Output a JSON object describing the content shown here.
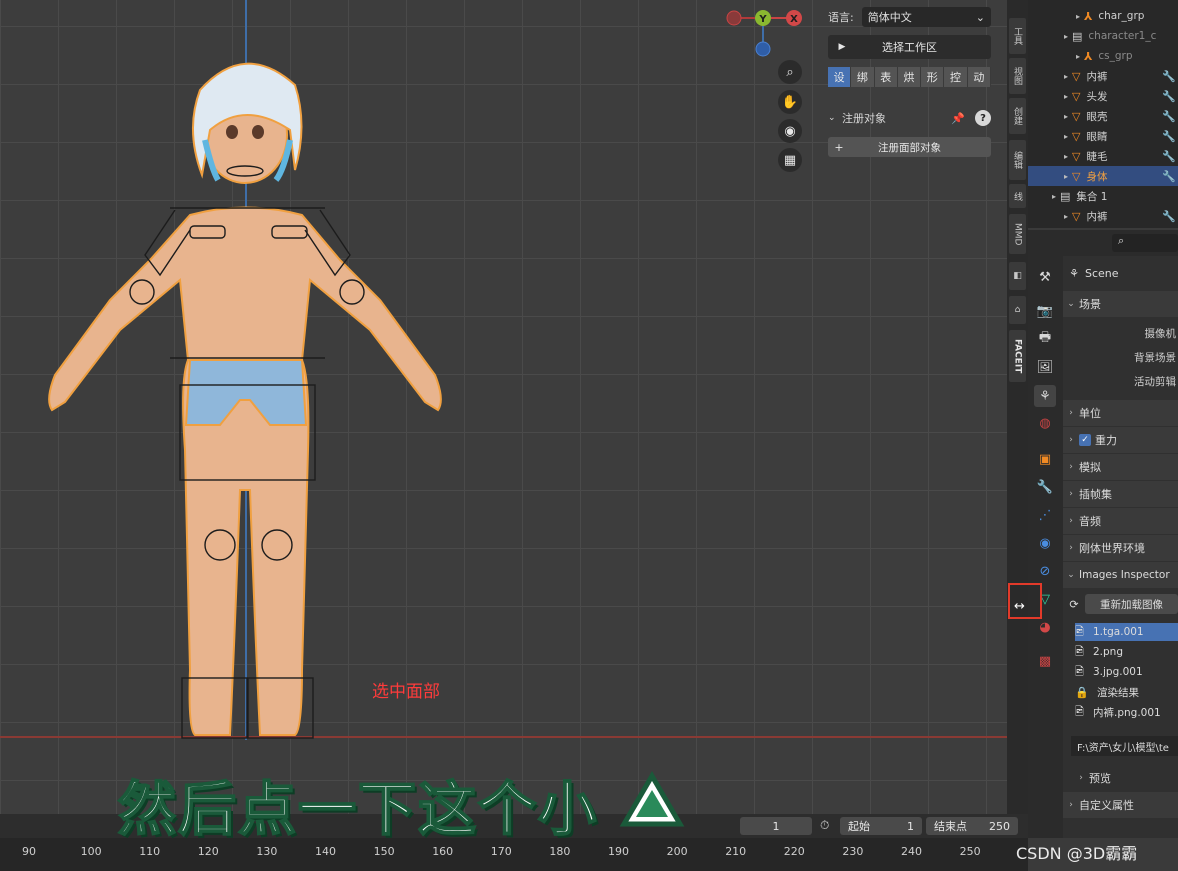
{
  "npanel": {
    "lang_label": "语言:",
    "lang_value": "简体中文",
    "workspace_btn": "选择工作区",
    "tabs": [
      "设",
      "绑",
      "表",
      "烘",
      "形",
      "控",
      "动"
    ],
    "register_header": "注册对象",
    "register_btn": "注册面部对象"
  },
  "vtabs": [
    "工具",
    "视图",
    "创建",
    "编辑",
    "线",
    "MMD",
    "",
    "",
    "FACEIT"
  ],
  "outliner": [
    {
      "name": "char_grp",
      "indent": 2,
      "icon": "armature",
      "sel": false
    },
    {
      "name": "character1_c",
      "indent": 1,
      "icon": "collection",
      "sel": false,
      "dim": true
    },
    {
      "name": "cs_grp",
      "indent": 2,
      "icon": "armature",
      "sel": false,
      "dim": true
    },
    {
      "name": "内裤",
      "indent": 1,
      "icon": "mesh",
      "sel": false
    },
    {
      "name": "头发",
      "indent": 1,
      "icon": "mesh",
      "sel": false
    },
    {
      "name": "眼壳",
      "indent": 1,
      "icon": "mesh",
      "sel": false
    },
    {
      "name": "眼睛",
      "indent": 1,
      "icon": "mesh",
      "sel": false
    },
    {
      "name": "睫毛",
      "indent": 1,
      "icon": "mesh",
      "sel": false
    },
    {
      "name": "身体",
      "indent": 1,
      "icon": "mesh",
      "sel": true
    },
    {
      "name": "集合 1",
      "indent": 0,
      "icon": "collection",
      "sel": false
    },
    {
      "name": "内裤",
      "indent": 1,
      "icon": "mesh",
      "sel": false
    }
  ],
  "props": {
    "scene_label": "Scene",
    "section_scene": "场景",
    "camera": "摄像机",
    "background_scene": "背景场景",
    "active_clip": "活动剪辑",
    "sections": [
      "单位",
      "重力",
      "模拟",
      "插帧集",
      "音频",
      "刚体世界环境"
    ],
    "gravity_checked": true,
    "images_inspector": "Images Inspector",
    "reload_btn": "重新加载图像",
    "images": [
      "1.tga.001",
      "2.png",
      "3.jpg.001",
      "渲染结果",
      "内裤.png.001"
    ],
    "path": "F:\\资产\\女儿\\模型\\te",
    "preview": "预览",
    "custom_props": "自定义属性"
  },
  "timeline": {
    "current_frame": "1",
    "start_label": "起始",
    "start": "1",
    "end_label": "结束点",
    "end": "250",
    "ticks": [
      "90",
      "100",
      "110",
      "120",
      "130",
      "140",
      "150",
      "160",
      "170",
      "180",
      "190",
      "200",
      "210",
      "220",
      "230",
      "240",
      "250"
    ]
  },
  "overlay": {
    "caption": "然后点一下这个小",
    "note": "选中面部",
    "watermark": "CSDN @3D霸霸"
  },
  "gizmo": {
    "y_label": "Y",
    "x_label": "X"
  }
}
